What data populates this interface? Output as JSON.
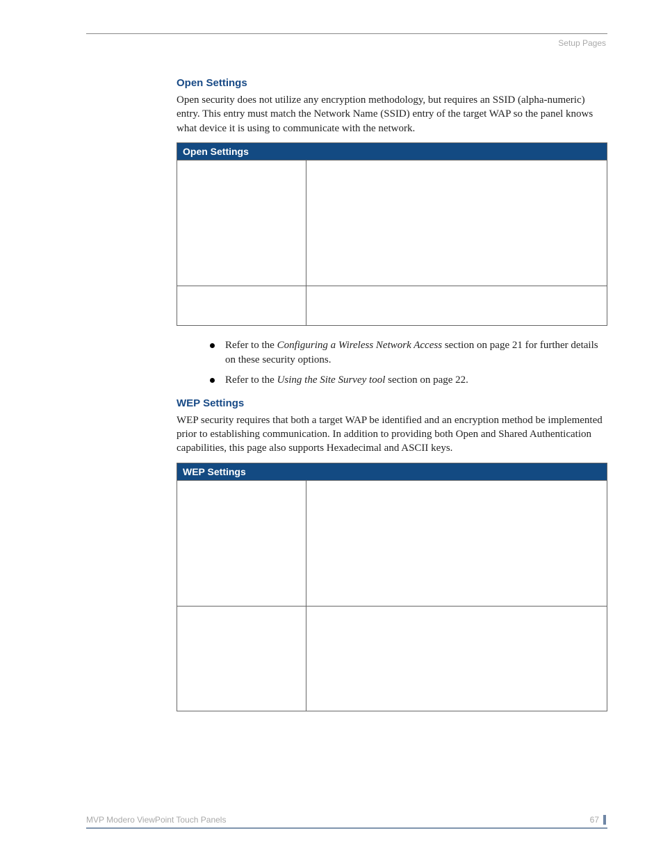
{
  "header": {
    "section_label": "Setup Pages"
  },
  "section1": {
    "heading": "Open Settings",
    "paragraph": "Open security does not utilize any encryption methodology, but requires an SSID (alpha-numeric) entry. This entry must match the Network Name (SSID) entry of the target WAP so the panel knows what device it is using to communicate with the network.",
    "table_title": "Open Settings"
  },
  "bullets": {
    "b1_pre": "Refer to the ",
    "b1_em": "Configuring a Wireless Network Access",
    "b1_post": " section on page 21 for further details on these security options.",
    "b2_pre": "Refer to the ",
    "b2_em": "Using the Site Survey tool",
    "b2_post": " section on page 22."
  },
  "section2": {
    "heading": "WEP Settings",
    "paragraph": "WEP security requires that both a target WAP be identified and an encryption method be implemented prior to establishing communication. In addition to providing both Open and Shared Authentication capabilities, this page also supports Hexadecimal and ASCII keys.",
    "table_title": "WEP Settings"
  },
  "footer": {
    "doc_title": "MVP Modero ViewPoint Touch Panels",
    "page_number": "67"
  }
}
